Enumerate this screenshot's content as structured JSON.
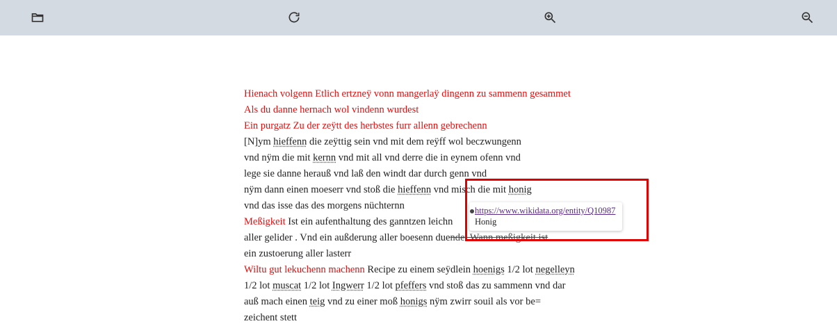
{
  "toolbar": {
    "icons": [
      "folder-open-icon",
      "refresh-icon",
      "zoom-in-icon",
      "zoom-out-icon"
    ]
  },
  "document": {
    "heading1": "Hienach volgenn Etlich ertzneÿ vonn mangerlaÿ dingenn zu sammenn gesammet",
    "heading2": "Als du danne hernach wol vindenn wurdest",
    "heading3": "Ein purgatz Zu der zeÿtt des herbstes furr allenn gebrechenn",
    "l4a": "[N]ym ",
    "l4b": "hieffenn",
    "l4c": " die zeÿttig sein vnd mit dem reÿff wol beczwungenn",
    "l5a": "vnd nÿm die mit ",
    "l5b": "kernn",
    "l5c": " vnd mit all vnd derre die in eynem ofenn vnd",
    "l6": "lege sie danne herauß vnd laß den windt dar durch genn vnd",
    "l7a": "nÿm dann einen moeserr vnd stoß die ",
    "l7b": "hieffenn",
    "l7c": " vnd misch die mit ",
    "l7d": "honig",
    "l8": "vnd das isse das des morgens nüchternn",
    "l9a": "Meßigkeit",
    "l9b": " Ist ein aufenthaltung des ganntzen leichn",
    "l10a": "aller gelider . Vnd ein außderung aller boesenn due",
    "l10b": "ndet Wann meßigkeit ist",
    "l11": "ein zustoerung aller lasterr",
    "l12a": "Wiltu gut lekuchenn machenn",
    "l12b": " Recipe zu einem seÿdlein ",
    "l12c": "hoenigs",
    "l12d": " 1/2 lot ",
    "l12e": "negelleyn",
    "l13a": "1/2 lot ",
    "l13b": "muscat",
    "l13c": " 1/2 lot ",
    "l13d": "Ingwerr",
    "l13e": " 1/2 lot ",
    "l13f": "pfeffers",
    "l13g": " vnd stoß das zu sammenn vnd dar",
    "l14a": "auß mach einen ",
    "l14b": "teig",
    "l14c": " vnd zu einer moß ",
    "l14d": "honigs",
    "l14e": " nÿm zwirr souil als vor be=",
    "l15": "zeichent stett"
  },
  "popup": {
    "link": "https://www.wikidata.org/entity/Q10987",
    "label": "Honig"
  },
  "colors": {
    "rubric": "#e30e0e",
    "toolbar": "#d4dae1",
    "highlight": "#e00000"
  }
}
